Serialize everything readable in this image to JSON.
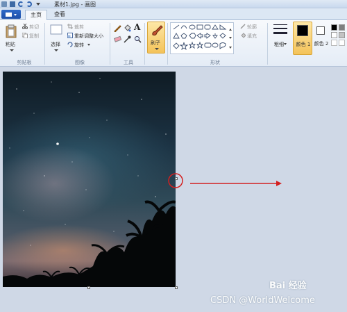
{
  "window": {
    "title": "素材1.jpg - 画图"
  },
  "tabs": [
    {
      "label": "主页"
    },
    {
      "label": "查看"
    }
  ],
  "ribbon": {
    "clipboard": {
      "label": "剪贴板",
      "paste": "粘贴",
      "cut": "剪切",
      "copy": "复制"
    },
    "image": {
      "label": "图像",
      "select": "选择",
      "crop": "裁剪",
      "resize": "重新调整大小",
      "rotate": "旋转"
    },
    "tools": {
      "label": "工具"
    },
    "brush": {
      "label": "刷子"
    },
    "shapes": {
      "label": "形状",
      "outline": "轮廓",
      "fill": "填充"
    },
    "size": {
      "label": "粗细"
    },
    "colors": {
      "color1": "颜色 1",
      "color2": "颜色 2"
    }
  },
  "colors": {
    "accent": "#f4c35a",
    "palette": [
      "#000000",
      "#7f7f7f",
      "#ffffff",
      "#c3c3c3"
    ],
    "arrow": "#d42020"
  },
  "watermarks": {
    "baidu": "Bai 经验",
    "csdn": "CSDN @WorldWelcome"
  }
}
